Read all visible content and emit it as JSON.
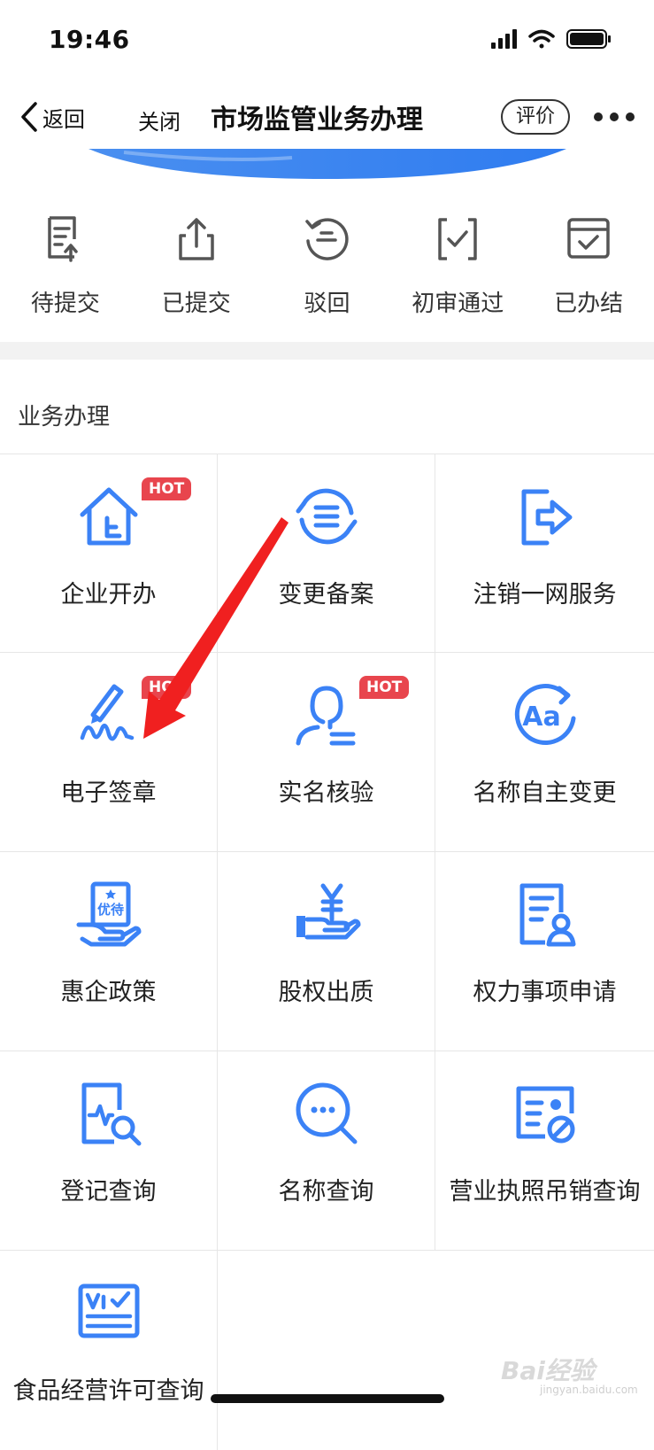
{
  "status_bar": {
    "time": "19:46"
  },
  "nav": {
    "back_label": "返回",
    "close_label": "关闭",
    "title": "市场监管业务办理",
    "rate_label": "评价"
  },
  "status_tabs": [
    {
      "label": "待提交",
      "icon": "doc-upload-icon"
    },
    {
      "label": "已提交",
      "icon": "share-upload-icon"
    },
    {
      "label": "驳回",
      "icon": "reject-undo-icon"
    },
    {
      "label": "初审通过",
      "icon": "check-doc-icon"
    },
    {
      "label": "已办结",
      "icon": "calendar-check-icon"
    }
  ],
  "section_title": "业务办理",
  "services": [
    {
      "label": "企业开办",
      "icon": "house-icon",
      "badge": "HOT"
    },
    {
      "label": "变更备案",
      "icon": "change-cycle-icon"
    },
    {
      "label": "注销一网服务",
      "icon": "exit-icon"
    },
    {
      "label": "电子签章",
      "icon": "signature-pen-icon",
      "badge": "HOT"
    },
    {
      "label": "实名核验",
      "icon": "person-verify-icon",
      "badge": "HOT"
    },
    {
      "label": "名称自主变更",
      "icon": "name-aa-icon"
    },
    {
      "label": "惠企政策",
      "icon": "preferential-hand-icon",
      "icon_text": "优待"
    },
    {
      "label": "股权出质",
      "icon": "yen-hand-icon"
    },
    {
      "label": "权力事项申请",
      "icon": "doc-person-icon"
    },
    {
      "label": "登记查询",
      "icon": "doc-search-icon"
    },
    {
      "label": "名称查询",
      "icon": "chat-search-icon"
    },
    {
      "label": "营业执照吊销查询",
      "icon": "license-revoke-icon"
    },
    {
      "label": "食品经营许可查询",
      "icon": "food-license-icon"
    }
  ],
  "colors": {
    "accent": "#3b82f6",
    "hot": "#e8454d",
    "arrow": "#f02020"
  },
  "watermark": {
    "text": "Bai经验",
    "sub": "jingyan.baidu.com"
  }
}
